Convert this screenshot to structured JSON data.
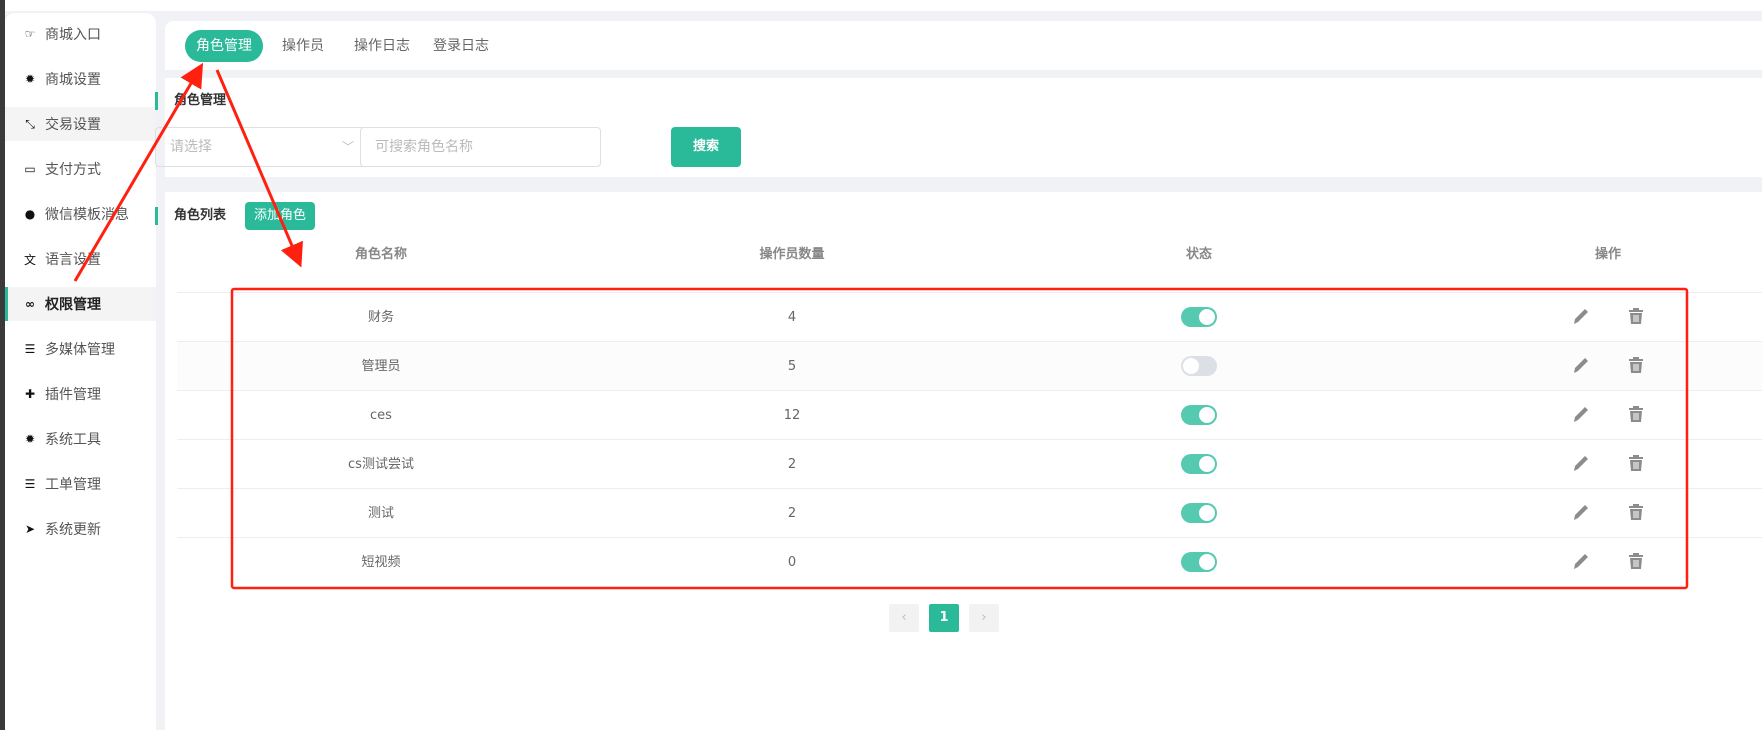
{
  "sidebar": {
    "items": [
      {
        "label": "商城入口",
        "icon": "pointing-hand-icon",
        "glyph": "☞"
      },
      {
        "label": "商城设置",
        "icon": "gear-icon",
        "glyph": "✹"
      },
      {
        "label": "交易设置",
        "icon": "exchange-icon",
        "glyph": "⤡"
      },
      {
        "label": "支付方式",
        "icon": "credit-card-icon",
        "glyph": "▭"
      },
      {
        "label": "微信模板消息",
        "icon": "wechat-icon",
        "glyph": "●"
      },
      {
        "label": "语言设置",
        "icon": "language-icon",
        "glyph": "⽂"
      },
      {
        "label": "权限管理",
        "icon": "gamepad-icon",
        "glyph": "∞"
      },
      {
        "label": "多媒体管理",
        "icon": "list-icon",
        "glyph": "☰"
      },
      {
        "label": "插件管理",
        "icon": "puzzle-icon",
        "glyph": "✚"
      },
      {
        "label": "系统工具",
        "icon": "gear-icon",
        "glyph": "✹"
      },
      {
        "label": "工单管理",
        "icon": "list-icon",
        "glyph": "☰"
      },
      {
        "label": "系统更新",
        "icon": "paper-plane-icon",
        "glyph": "➤"
      }
    ],
    "active": "权限管理"
  },
  "tabs": [
    "角色管理",
    "操作员",
    "操作日志",
    "登录日志"
  ],
  "search": {
    "title": "角色管理",
    "select_placeholder": "请选择",
    "input_placeholder": "可搜索角色名称",
    "button": "搜索"
  },
  "list": {
    "title": "角色列表",
    "add_button": "添加角色",
    "columns": [
      "角色名称",
      "操作员数量",
      "状态",
      "操作"
    ],
    "rows": [
      {
        "name": "财务",
        "count": "4",
        "enabled": true
      },
      {
        "name": "管理员",
        "count": "5",
        "enabled": false
      },
      {
        "name": "ces",
        "count": "12",
        "enabled": true
      },
      {
        "name": "cs测试尝试",
        "count": "2",
        "enabled": true
      },
      {
        "name": "测试",
        "count": "2",
        "enabled": true
      },
      {
        "name": "短视频",
        "count": "0",
        "enabled": true
      }
    ]
  },
  "pagination": {
    "prev": "‹",
    "current": "1",
    "next": "›"
  },
  "colors": {
    "accent": "#2aba9a",
    "annotation": "#ff2010"
  }
}
